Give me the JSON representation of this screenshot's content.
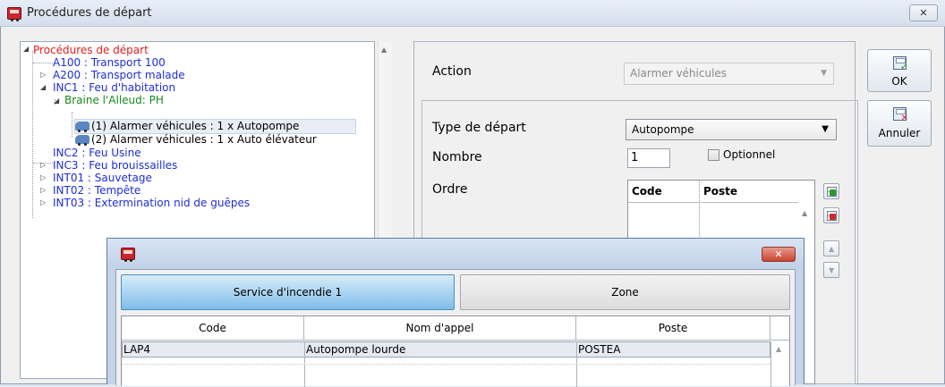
{
  "window": {
    "title": "Procédures de départ",
    "close_glyph": "✕"
  },
  "tree": {
    "root": "Procédures de départ",
    "items": [
      "A100 : Transport 100",
      "A200 : Transport malade",
      "INC1 : Feu d'habitation",
      "Braine l'Alleud: PH",
      "(1) Alarmer véhicules : 1 x Autopompe",
      "(2) Alarmer véhicules : 1 x Auto élévateur",
      "INC2 : Feu  Usine",
      "INC3 : Feu brouissailles",
      "INT01 : Sauvetage",
      "INT02 : Tempête",
      "INT03 : Extermination nid de guêpes"
    ]
  },
  "form": {
    "action_label": "Action",
    "action_value": "Alarmer véhicules",
    "type_label": "Type de départ",
    "type_value": "Autopompe",
    "nombre_label": "Nombre",
    "nombre_value": "1",
    "optionnel_label": "Optionnel",
    "ordre_label": "Ordre",
    "ordre_columns": [
      "Code",
      "Poste"
    ]
  },
  "buttons": {
    "ok": "OK",
    "cancel": "Annuler"
  },
  "popup": {
    "tabs": [
      "Service d'incendie 1",
      "Zone"
    ],
    "columns": [
      "Code",
      "Nom d'appel",
      "Poste"
    ],
    "rows": [
      {
        "code": "LAP4",
        "nom": "Autopompe lourde",
        "poste": "POSTEA"
      }
    ]
  },
  "colors": {
    "root": "#e41b1b",
    "procedure": "#1e2ed8",
    "location": "#178a1e",
    "active_tab": "#7fbde8"
  }
}
